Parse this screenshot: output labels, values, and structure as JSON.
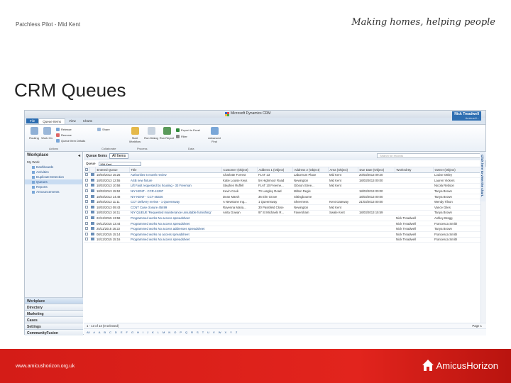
{
  "slide": {
    "subtitle": "Patchless Pilot - Mid Kent",
    "tagline": "Making homes, helping people",
    "title": "CRM Queues",
    "footer_url": "www.amicushorizon.org.uk",
    "logo_text": "AmicusHorizon"
  },
  "crm": {
    "window_title": "Microsoft Dynamics CRM",
    "user_name": "Nick Treadwell",
    "user_org": "AmicusH...",
    "tabs": [
      "File",
      "Queue Items",
      "View",
      "Charts"
    ],
    "ribbon": {
      "buttons": [
        {
          "label": "Routing",
          "icon": "routing-icon"
        },
        {
          "label": "Work On",
          "icon": "work-on-icon"
        },
        {
          "label": "Start Workflow",
          "icon": "workflow-icon"
        },
        {
          "label": "Run Dialog",
          "icon": "dialog-icon"
        },
        {
          "label": "Run Report",
          "icon": "report-icon"
        },
        {
          "label": "Advanced Find",
          "icon": "advanced-find-icon"
        }
      ],
      "small": [
        "Release",
        "Remove",
        "Queue Item Details",
        "Share",
        "Export to Excel",
        "Filter"
      ],
      "groups": [
        "Actions",
        "Collaborate",
        "Process",
        "Data"
      ]
    },
    "nav": {
      "header": "Workplace",
      "section": "My Work",
      "items": [
        "Dashboards",
        "Activities",
        "Duplicate Detection",
        "Queues",
        "Reports",
        "Announcements"
      ],
      "selected_index": 3,
      "areas": [
        "Workplace",
        "Directory",
        "Marketing",
        "Cases",
        "Settings",
        "CommunityFusion"
      ]
    },
    "view": {
      "title": "Queue Items",
      "selected_view": "All Items",
      "search_placeholder": "Search for records",
      "queue_label": "Queue",
      "queue_value": "Mid Kent"
    },
    "columns": [
      "Entered Queue",
      "Title",
      "Customer (Object)",
      "Address 1 (Object)",
      "Address 2 (Object)",
      "Area (Object)",
      "Due Date (Object)",
      "Worked By",
      "Owner (Object)"
    ],
    "rows": [
      [
        "18/03/2013 15:25",
        "Authorities 6 month review",
        "Charlotte Forrest",
        "FLAT 13",
        "Laburnum Place",
        "Mid Kent",
        "20/03/2013 09:20",
        "",
        "Louise Ottley"
      ],
      [
        "18/03/2013 12:55",
        "ASB new fixture",
        "Katie Louise Keys",
        "5A Highmoor Road",
        "Newington",
        "Mid Kent",
        "18/03/2013 00:00",
        "",
        "Lauren Vickers"
      ],
      [
        "18/03/2013 10:58",
        "Lift Fault requested by housing - 33 Freeman",
        "Stephen Ruffell",
        "FLAT 10 Freeme...",
        "Gibson Stree...",
        "Mid Kent",
        "",
        "",
        "Nicola Rebson"
      ],
      [
        "18/03/2013 15:52",
        "NIY KENT - CCR-41297",
        "Kevin Cook",
        "70 Langley Road",
        "Milton Regis",
        "",
        "18/03/2013 00:00",
        "",
        "Tanya Brown"
      ],
      [
        "18/03/2013 14:48",
        "NIY KENT - CCT-45326",
        "Dean Marsh",
        "36 Elm Grove",
        "Sittingbourne",
        "",
        "18/03/2013 00:00",
        "",
        "Tanya Brown"
      ],
      [
        "18/03/2013 11:11",
        "CCT Delivery review - 1 Queensway",
        "A Newstone Ing...",
        "1 Queensway",
        "Sheerness",
        "Kent Gateway",
        "21/03/2013 00:00",
        "",
        "Wendy Tilson"
      ],
      [
        "18/03/2013 09:43",
        "CCNT Case closure 45499",
        "Ravenna Maria...",
        "30 Passfield Close",
        "Newington",
        "Mid Kent",
        "",
        "",
        "Vance Giles"
      ],
      [
        "18/03/2013 16:11",
        "NIY QUEUE 'Requested maintenance unsuitable furnishing'",
        "Anita Gowan",
        "97 St Michaels R...",
        "Faversham",
        "Swale Kent",
        "18/03/2013 15:59",
        "",
        "Tanya Brown"
      ],
      [
        "22/12/2015 13:58",
        "Programmed works No access spreadsheet",
        "",
        "",
        "",
        "",
        "",
        "Nick Treadwell",
        "Ashley Bragg"
      ],
      [
        "09/12/2015 13:44",
        "Programmed works No access spreadsheet",
        "",
        "",
        "",
        "",
        "",
        "Nick Treadwell",
        "Francesca Smith"
      ],
      [
        "25/11/2015 16:22",
        "Programmed works No access addresses spreadsheet",
        "",
        "",
        "",
        "",
        "",
        "Nick Treadwell",
        "Tanya Brown"
      ],
      [
        "08/12/2015 15:14",
        "Programmed works no access spreadsheet",
        "",
        "",
        "",
        "",
        "",
        "Nick Treadwell",
        "Francesca Smith"
      ],
      [
        "10/12/2015 15:16",
        "Programmed works No access spreadsheet",
        "",
        "",
        "",
        "",
        "",
        "Nick Treadwell",
        "Francesca Smith"
      ]
    ],
    "status": "1 - 13 of 13 (0 selected)",
    "page": "Page 1",
    "alpha": [
      "All",
      "#",
      "A",
      "B",
      "C",
      "D",
      "E",
      "F",
      "G",
      "H",
      "I",
      "J",
      "K",
      "L",
      "M",
      "N",
      "O",
      "P",
      "Q",
      "R",
      "S",
      "T",
      "U",
      "V",
      "W",
      "X",
      "Y",
      "Z"
    ],
    "side_tab": "Click here to view the chart."
  },
  "colors": {
    "footer_red": "#d41c17",
    "crm_blue": "#1f4f8a"
  }
}
